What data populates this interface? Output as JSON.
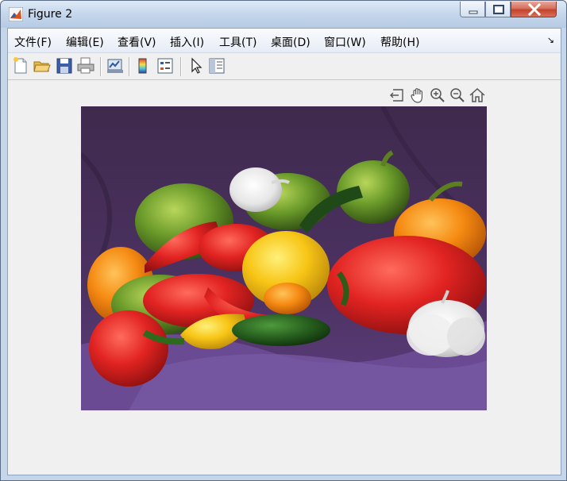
{
  "window": {
    "title": "Figure 2"
  },
  "menu": [
    {
      "label": "文件(F)"
    },
    {
      "label": "编辑(E)"
    },
    {
      "label": "查看(V)"
    },
    {
      "label": "插入(I)"
    },
    {
      "label": "工具(T)"
    },
    {
      "label": "桌面(D)"
    },
    {
      "label": "窗口(W)"
    },
    {
      "label": "帮助(H)"
    }
  ],
  "toolbar_icons": [
    "new-figure-icon",
    "open-file-icon",
    "save-icon",
    "print-icon",
    "link-plot-icon",
    "colorbar-icon",
    "legend-icon",
    "pointer-icon",
    "property-inspector-icon"
  ],
  "axes_toolbar_icons": [
    "export-icon",
    "pan-hand-icon",
    "zoom-in-icon",
    "zoom-out-icon",
    "home-icon"
  ],
  "colors": {
    "titlebar": "#c3d5ea",
    "client_bg": "#f0f0f0",
    "image_bg": "#4a2e55",
    "close_button": "#c4432c"
  },
  "image": {
    "subject": "peppers"
  }
}
